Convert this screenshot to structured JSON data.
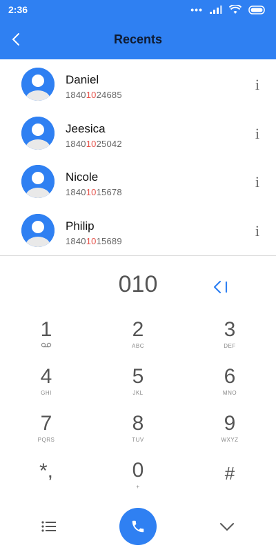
{
  "status": {
    "time": "2:36"
  },
  "header": {
    "title": "Recents"
  },
  "contacts": [
    {
      "name": "Daniel",
      "pre": "1840",
      "match": "10",
      "post": "24685",
      "info": "i"
    },
    {
      "name": "Jeesica",
      "pre": "1840",
      "match": "10",
      "post": "25042",
      "info": "i"
    },
    {
      "name": "Nicole",
      "pre": "1840",
      "match": "10",
      "post": "15678",
      "info": "i"
    },
    {
      "name": "Philip",
      "pre": "1840",
      "match": "10",
      "post": "15689",
      "info": "i"
    }
  ],
  "dialer": {
    "entry": "010"
  },
  "keypad": [
    {
      "digit": "1",
      "letters": ""
    },
    {
      "digit": "2",
      "letters": "ABC"
    },
    {
      "digit": "3",
      "letters": "DEF"
    },
    {
      "digit": "4",
      "letters": "GHI"
    },
    {
      "digit": "5",
      "letters": "JKL"
    },
    {
      "digit": "6",
      "letters": "MNO"
    },
    {
      "digit": "7",
      "letters": "PQRS"
    },
    {
      "digit": "8",
      "letters": "TUV"
    },
    {
      "digit": "9",
      "letters": "WXYZ"
    },
    {
      "digit": "*,",
      "letters": ""
    },
    {
      "digit": "0",
      "letters": "+"
    },
    {
      "digit": "#",
      "letters": ""
    }
  ],
  "colors": {
    "accent": "#2f80f2",
    "highlight": "#e5534b"
  }
}
